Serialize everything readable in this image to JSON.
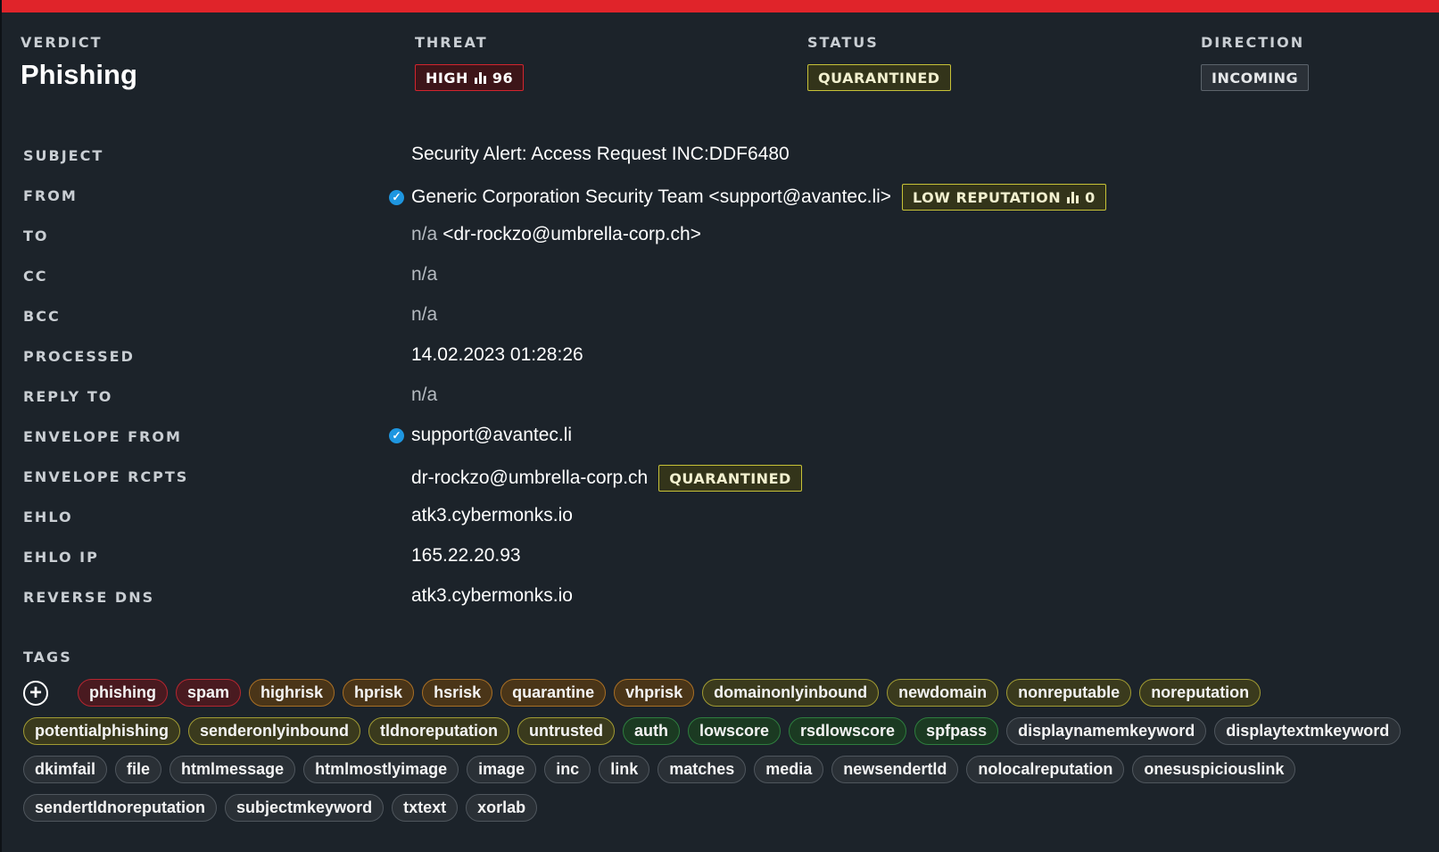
{
  "header": {
    "verdict": {
      "label": "VERDICT",
      "value": "Phishing"
    },
    "threat": {
      "label": "THREAT",
      "level": "HIGH",
      "score": "96"
    },
    "status": {
      "label": "STATUS",
      "value": "QUARANTINED"
    },
    "direction": {
      "label": "DIRECTION",
      "value": "INCOMING"
    }
  },
  "fields": {
    "subject": {
      "label": "SUBJECT",
      "value": "Security Alert: Access Request INC:DDF6480"
    },
    "from": {
      "label": "FROM",
      "value": "Generic Corporation Security Team <support@avantec.li>",
      "verified": true,
      "reputation_label": "LOW REPUTATION",
      "reputation_score": "0"
    },
    "to": {
      "label": "TO",
      "name": "n/a",
      "address": "<dr-rockzo@umbrella-corp.ch>"
    },
    "cc": {
      "label": "CC",
      "value": "n/a"
    },
    "bcc": {
      "label": "BCC",
      "value": "n/a"
    },
    "processed": {
      "label": "PROCESSED",
      "value": "14.02.2023 01:28:26"
    },
    "reply_to": {
      "label": "REPLY TO",
      "value": "n/a"
    },
    "envelope_from": {
      "label": "ENVELOPE FROM",
      "value": "support@avantec.li",
      "verified": true
    },
    "envelope_rcpts": {
      "label": "ENVELOPE RCPTS",
      "value": "dr-rockzo@umbrella-corp.ch",
      "status": "QUARANTINED"
    },
    "ehlo": {
      "label": "EHLO",
      "value": "atk3.cybermonks.io"
    },
    "ehlo_ip": {
      "label": "EHLO IP",
      "value": "165.22.20.93"
    },
    "reverse_dns": {
      "label": "REVERSE DNS",
      "value": "atk3.cybermonks.io"
    }
  },
  "tags_section": {
    "label": "TAGS",
    "add_icon": "plus-circle-icon",
    "rows": [
      [
        {
          "text": "phishing",
          "tone": "red"
        },
        {
          "text": "spam",
          "tone": "red"
        },
        {
          "text": "highrisk",
          "tone": "orange"
        },
        {
          "text": "hprisk",
          "tone": "orange"
        },
        {
          "text": "hsrisk",
          "tone": "orange"
        },
        {
          "text": "quarantine",
          "tone": "orange"
        },
        {
          "text": "vhprisk",
          "tone": "orange"
        },
        {
          "text": "domainonlyinbound",
          "tone": "yellow"
        },
        {
          "text": "newdomain",
          "tone": "yellow"
        },
        {
          "text": "nonreputable",
          "tone": "yellow"
        },
        {
          "text": "noreputation",
          "tone": "yellow"
        }
      ],
      [
        {
          "text": "potentialphishing",
          "tone": "yellow"
        },
        {
          "text": "senderonlyinbound",
          "tone": "yellow"
        },
        {
          "text": "tldnoreputation",
          "tone": "yellow"
        },
        {
          "text": "untrusted",
          "tone": "yellow"
        },
        {
          "text": "auth",
          "tone": "green"
        },
        {
          "text": "lowscore",
          "tone": "green"
        },
        {
          "text": "rsdlowscore",
          "tone": "green"
        },
        {
          "text": "spfpass",
          "tone": "green"
        },
        {
          "text": "displaynamemkeyword",
          "tone": "grey"
        },
        {
          "text": "displaytextmkeyword",
          "tone": "grey"
        }
      ],
      [
        {
          "text": "dkimfail",
          "tone": "grey"
        },
        {
          "text": "file",
          "tone": "grey"
        },
        {
          "text": "htmlmessage",
          "tone": "grey"
        },
        {
          "text": "htmlmostlyimage",
          "tone": "grey"
        },
        {
          "text": "image",
          "tone": "grey"
        },
        {
          "text": "inc",
          "tone": "grey"
        },
        {
          "text": "link",
          "tone": "grey"
        },
        {
          "text": "matches",
          "tone": "grey"
        },
        {
          "text": "media",
          "tone": "grey"
        },
        {
          "text": "newsendertld",
          "tone": "grey"
        },
        {
          "text": "nolocalreputation",
          "tone": "grey"
        },
        {
          "text": "onesuspiciouslink",
          "tone": "grey"
        }
      ],
      [
        {
          "text": "sendertldnoreputation",
          "tone": "grey"
        },
        {
          "text": "subjectmkeyword",
          "tone": "grey"
        },
        {
          "text": "txtext",
          "tone": "grey"
        },
        {
          "text": "xorlab",
          "tone": "grey"
        }
      ]
    ]
  },
  "colors": {
    "alert_bar": "#e0242a",
    "background": "#1c232a",
    "threat_high": "#d2252e",
    "quarantined": "#c7c237",
    "verified": "#1e96e0"
  }
}
